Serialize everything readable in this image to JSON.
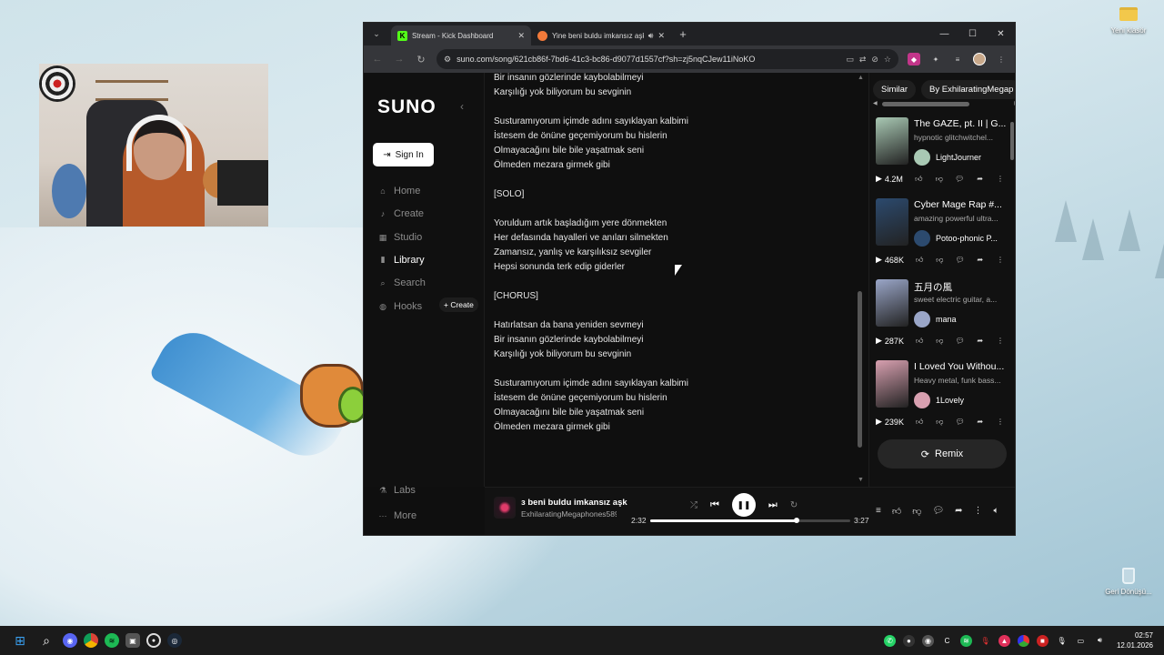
{
  "desktop": {
    "folder_label": "Yeni klasör",
    "recycle_label": "Geri Dönüşü..."
  },
  "browser": {
    "tabs": [
      {
        "title": "Stream - Kick Dashboard",
        "favicon": "kick-icon",
        "color": "#53fc18",
        "active": true
      },
      {
        "title": "Yine beni buldu imkansız aşk",
        "favicon": "suno-icon",
        "color": "#f27a3a",
        "active": false
      }
    ],
    "url": "suno.com/song/621cb86f-7bd6-41c3-bc86-d9077d1557cf?sh=zj5nqCJew11iNoKO"
  },
  "sidebar": {
    "logo": "SUNO",
    "sign_in": "Sign In",
    "items": [
      {
        "label": "Home",
        "icon": "home-icon"
      },
      {
        "label": "Create",
        "icon": "music-note-icon"
      },
      {
        "label": "Studio",
        "icon": "studio-icon"
      },
      {
        "label": "Library",
        "icon": "library-icon",
        "active": true
      },
      {
        "label": "Search",
        "icon": "search-icon"
      },
      {
        "label": "Hooks",
        "icon": "hooks-icon"
      }
    ],
    "hooks_create": "+ Create",
    "labs": "Labs",
    "more": "More"
  },
  "lyrics": [
    "Bir insanın gözlerinde kaybolabilmeyi",
    "Karşılığı yok biliyorum bu sevginin",
    "",
    "Susturamıyorum içimde adını sayıklayan kalbimi",
    "İstesem de önüne geçemiyorum bu hislerin",
    "Olmayacağını bile bile yaşatmak seni",
    "Ölmeden mezara girmek gibi",
    "",
    "[SOLO]",
    "",
    "Yoruldum artık başladığım yere dönmekten",
    "Her defasında hayalleri ve anıları silmekten",
    "Zamansız, yanlış ve karşılıksız sevgiler",
    "Hepsi sonunda terk edip giderler",
    "",
    "[CHORUS]",
    "",
    "Hatırlatsan da bana yeniden sevmeyi",
    "Bir insanın gözlerinde kaybolabilmeyi",
    "Karşılığı yok biliyorum bu sevginin",
    "",
    "Susturamıyorum içimde adını sayıklayan kalbimi",
    "İstesem de önüne geçemiyorum bu hislerin",
    "Olmayacağını bile bile yaşatmak seni",
    "Ölmeden mezara girmek gibi"
  ],
  "right_panel": {
    "chips": [
      "Similar",
      "By ExhilaratingMegap"
    ],
    "songs": [
      {
        "title": "The GAZE, pt. II | G...",
        "desc": "hypnotic glitchwitchel...",
        "artist": "LightJourner",
        "plays": "4.2M",
        "thumb_color": "#a9c9b4"
      },
      {
        "title": "Cyber Mage Rap #...",
        "desc": "amazing powerful ultra...",
        "artist": "Potoo-phonic P...",
        "plays": "468K",
        "thumb_color": "#2c4a6e"
      },
      {
        "title": "五月の風",
        "desc": "sweet electric guitar, a...",
        "artist": "mana",
        "plays": "287K",
        "thumb_color": "#9aa6c8"
      },
      {
        "title": "I Loved You Withou...",
        "desc": "Heavy metal, funk bass...",
        "artist": "1Lovely",
        "plays": "239K",
        "thumb_color": "#d8a0b0"
      }
    ],
    "remix": "Remix"
  },
  "player": {
    "title": "ɜ beni buldu imkansız aşk",
    "artist": "ExhilaratingMegaphones589",
    "elapsed": "2:32",
    "duration": "3:27",
    "progress": 0.734
  },
  "taskbar": {
    "time": "02:57",
    "date": "12.01.2026"
  }
}
